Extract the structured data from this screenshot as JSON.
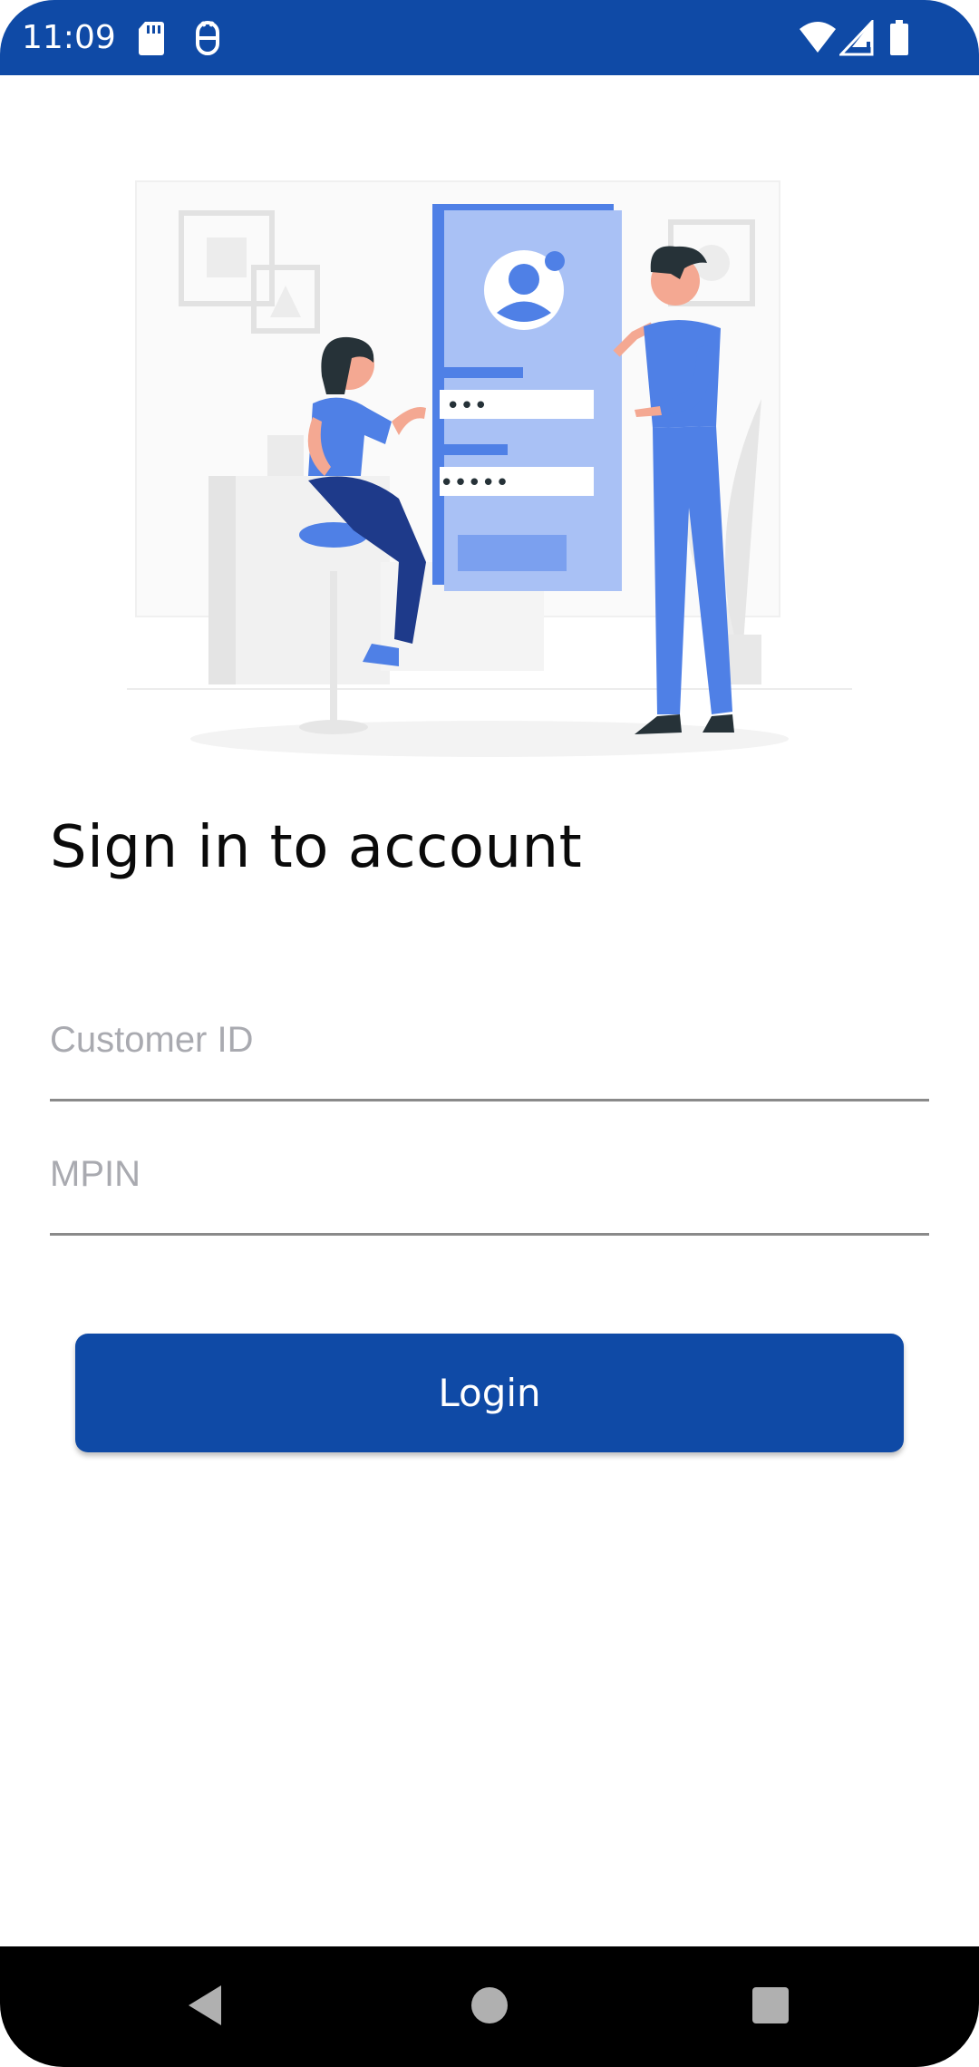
{
  "status_bar": {
    "time": "11:09",
    "icons": [
      "sd-card-icon",
      "debug-bot-icon",
      "wifi-icon",
      "signal-icon",
      "battery-icon"
    ],
    "background": "#0f4aa6"
  },
  "illustration": {
    "icon": "login-illustration-icon",
    "password_dots_short": "•••",
    "password_dots_long": "•••••"
  },
  "page": {
    "title": "Sign in to account"
  },
  "form": {
    "customer_id": {
      "placeholder": "Customer ID",
      "value": ""
    },
    "mpin": {
      "placeholder": "MPIN",
      "value": ""
    },
    "login_label": "Login"
  },
  "nav_bar": {
    "items": [
      "back-icon",
      "home-icon",
      "recents-icon"
    ]
  },
  "colors": {
    "brand": "#0f4aa6",
    "accent": "#4f80e6",
    "placeholder": "#a9aab0"
  }
}
